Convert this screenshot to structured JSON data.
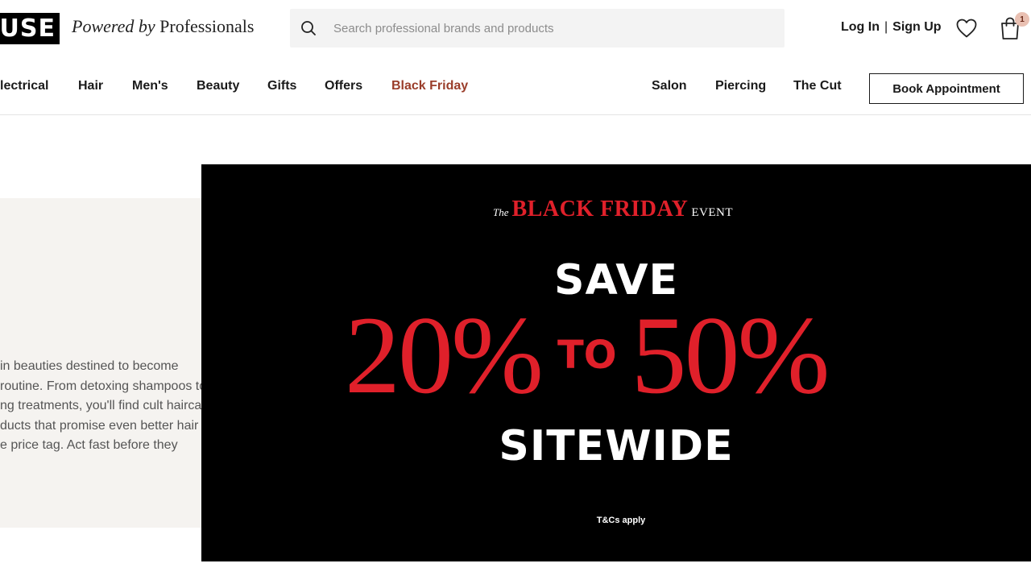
{
  "brand": {
    "logo_text": "USE",
    "tagline_italic": "Powered by",
    "tagline_rest": "Professionals"
  },
  "search": {
    "placeholder": "Search professional brands and products",
    "icon": "search-icon"
  },
  "account": {
    "login": "Log In",
    "separator": "|",
    "signup": "Sign Up",
    "wishlist_icon": "heart-icon",
    "bag_icon": "shopping-bag-icon",
    "bag_count": "1"
  },
  "nav": {
    "left": [
      "lectrical",
      "Hair",
      "Men's",
      "Beauty",
      "Gifts",
      "Offers",
      "Black Friday"
    ],
    "right": [
      "Salon",
      "Piercing",
      "The Cut"
    ],
    "book_button": "Book Appointment",
    "promo_color": "#9a3d2a"
  },
  "intro": {
    "text": "in beauties destined to become\nroutine. From detoxing shampoos to\nng treatments, you'll find cult haircare\nducts that promise even better hair\ne price tag. Act fast before they"
  },
  "banner": {
    "event_prefix": "The",
    "event_title": "BLACK FRIDAY",
    "event_suffix": "EVENT",
    "save": "SAVE",
    "from_pct": "20%",
    "to": "TO",
    "to_pct": "50%",
    "sitewide": "SITEWIDE",
    "terms": "T&Cs apply",
    "accent_color": "#e0202a",
    "background_color": "#000000"
  }
}
